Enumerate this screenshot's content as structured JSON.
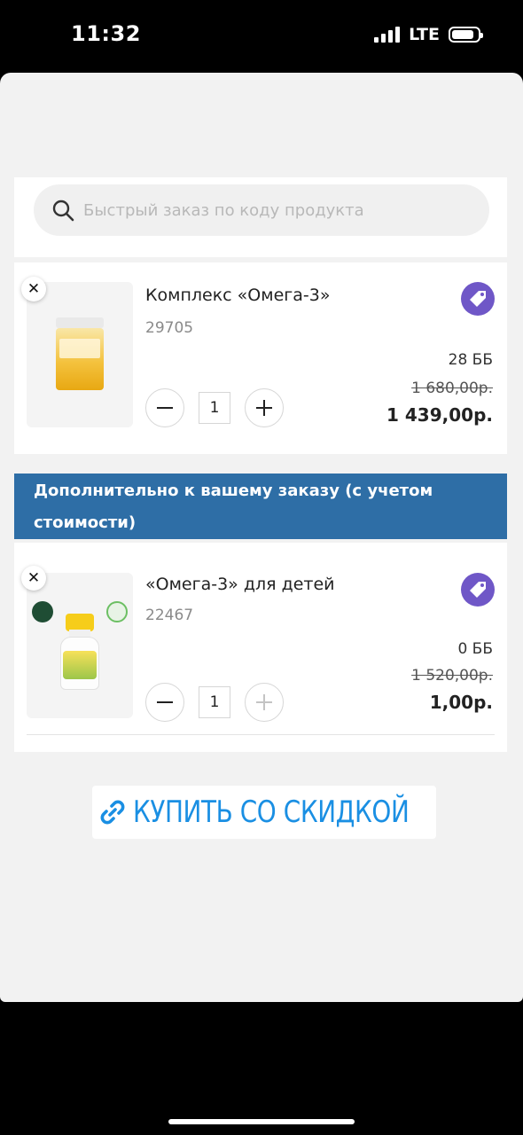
{
  "status_bar": {
    "time": "11:32",
    "network": "LTE"
  },
  "search": {
    "placeholder": "Быстрый заказ по коду продукта",
    "value": ""
  },
  "cart_items": [
    {
      "name": "Комплекс «Омега-3»",
      "code": "29705",
      "points": "28 ББ",
      "old_price": "1 680,00р.",
      "price": "1 439,00р.",
      "quantity": "1",
      "remove_symbol": "✕"
    }
  ],
  "additional_banner": {
    "text": "Дополнительно к вашему заказу (с учетом стоимости)"
  },
  "additional_items": [
    {
      "name": "«Омега-3» для детей",
      "code": "22467",
      "points": "0 ББ",
      "old_price": "1 520,00р.",
      "price": "1,00р.",
      "quantity": "1",
      "remove_symbol": "✕"
    }
  ],
  "promo_link": {
    "label": "КУПИТЬ СО СКИДКОЙ",
    "color": "#1a8fe3"
  },
  "colors": {
    "tag_button": "#6f57c7",
    "banner": "#2e6ea6"
  },
  "icons": {
    "search": "search-icon",
    "tag": "price-tag-icon",
    "link": "link-icon",
    "minus": "minus-icon",
    "plus": "plus-icon",
    "close": "close-icon"
  }
}
